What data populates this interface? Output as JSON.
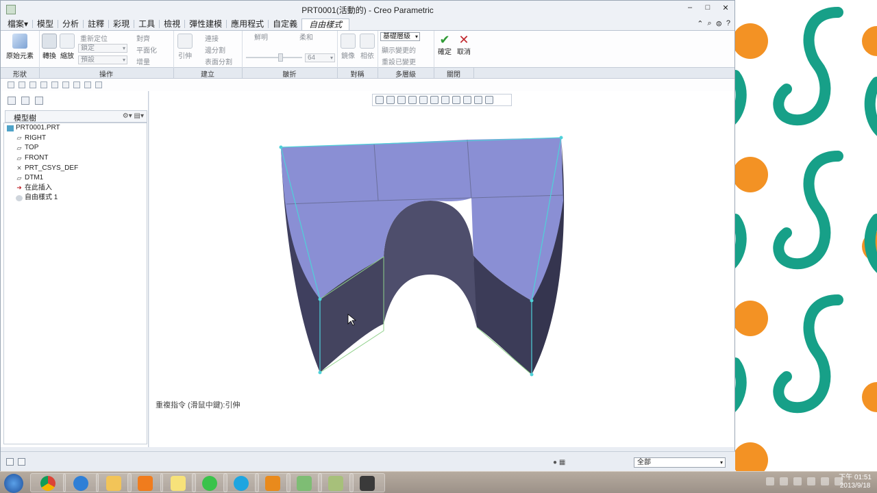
{
  "window": {
    "title": "PRT0001(活動的) - Creo Parametric",
    "controls": [
      "–",
      "□",
      "✕"
    ]
  },
  "ribbon": {
    "tabs": [
      {
        "label": "檔案▾"
      },
      {
        "label": "模型"
      },
      {
        "label": "分析"
      },
      {
        "label": "註釋"
      },
      {
        "label": "彩現"
      },
      {
        "label": "工具"
      },
      {
        "label": "檢視"
      },
      {
        "label": "彈性建模"
      },
      {
        "label": "應用程式"
      },
      {
        "label": "自定義"
      },
      {
        "label": "自由樣式",
        "active": true
      }
    ],
    "buttons": {
      "primitive": "原始元素",
      "transform": "轉換",
      "scale": "縮放",
      "reposition": "重新定位",
      "lock": "鎖定",
      "default": "預設",
      "align": "對齊",
      "flatten": "平面化",
      "increment": "增量",
      "extrude": "引伸",
      "connect": "連接",
      "edge_split": "邊分割",
      "face_split": "表面分割",
      "sharp": "鮮明",
      "soft": "柔和",
      "crease_value": "64",
      "mirror": "鏡像",
      "relative": "相依",
      "base_level": "基礎層級",
      "show_changed": "顯示變更的",
      "reset_changed": "重設已變更",
      "ok": "確定",
      "cancel": "取消"
    },
    "groups": [
      "形狀",
      "操作",
      "建立",
      "皺折",
      "對稱",
      "多層級",
      "關閉"
    ]
  },
  "model_tree": {
    "title": "模型樹",
    "items": [
      {
        "label": "PRT0001.PRT",
        "icon": "part-icon",
        "root": true
      },
      {
        "label": "RIGHT",
        "icon": "datum-plane-icon"
      },
      {
        "label": "TOP",
        "icon": "datum-plane-icon"
      },
      {
        "label": "FRONT",
        "icon": "datum-plane-icon"
      },
      {
        "label": "PRT_CSYS_DEF",
        "icon": "csys-icon"
      },
      {
        "label": "DTM1",
        "icon": "datum-plane-icon"
      },
      {
        "label": "在此插入",
        "icon": "insert-arrow-icon"
      },
      {
        "label": "自由樣式 1",
        "icon": "freestyle-icon"
      }
    ]
  },
  "graphics": {
    "message": "重複指令 (滑鼠中鍵):引伸"
  },
  "status": {
    "filter_value": "全部"
  },
  "taskbar": {
    "clock_time": "下午 01:51",
    "clock_date": "2013/9/18"
  },
  "colors": {
    "surface_top": "#8a8fd4",
    "surface_side": "#40405e",
    "accent_teal": "#17a088",
    "accent_orange": "#f39224",
    "ok_green": "#2f9a35",
    "cancel_red": "#c0262c"
  }
}
